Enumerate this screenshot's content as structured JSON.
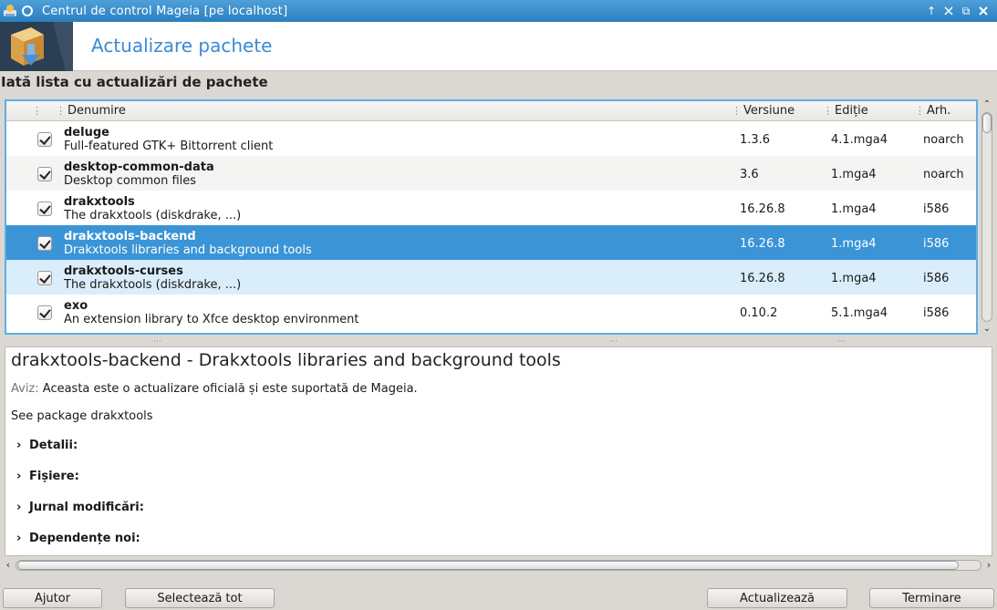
{
  "window": {
    "title": "Centrul de control Mageia  [pe localhost]",
    "controls": [
      "↑",
      "✕",
      "⧉",
      "✕"
    ]
  },
  "banner": {
    "title": "Actualizare pachete"
  },
  "list_heading": "Iată lista cu actualizări de pachete",
  "table": {
    "columns": {
      "name": "Denumire",
      "version": "Versiune",
      "release": "Ediție",
      "arch": "Arh."
    },
    "rows": [
      {
        "name": "deluge",
        "summary": "Full-featured GTK+ Bittorrent client",
        "version": "1.3.6",
        "release": "4.1.mga4",
        "arch": "noarch",
        "checked": true
      },
      {
        "name": "desktop-common-data",
        "summary": "Desktop common files",
        "version": "3.6",
        "release": "1.mga4",
        "arch": "noarch",
        "checked": true
      },
      {
        "name": "drakxtools",
        "summary": "The drakxtools (diskdrake, ...)",
        "version": "16.26.8",
        "release": "1.mga4",
        "arch": "i586",
        "checked": true
      },
      {
        "name": "drakxtools-backend",
        "summary": "Drakxtools libraries and background tools",
        "version": "16.26.8",
        "release": "1.mga4",
        "arch": "i586",
        "checked": true
      },
      {
        "name": "drakxtools-curses",
        "summary": "The drakxtools (diskdrake, ...)",
        "version": "16.26.8",
        "release": "1.mga4",
        "arch": "i586",
        "checked": true
      },
      {
        "name": "exo",
        "summary": "An extension library to Xfce desktop environment",
        "version": "0.10.2",
        "release": "5.1.mga4",
        "arch": "i586",
        "checked": true
      }
    ]
  },
  "detail": {
    "title": "drakxtools-backend - Drakxtools libraries and background tools",
    "notice_label": "Aviz:",
    "notice_text": "Aceasta este o actualizare oficială și este suportată de Mageia.",
    "see_package": "See package drakxtools",
    "sections": [
      "Detalii:",
      "Fișiere:",
      "Jurnal modificări:",
      "Dependențe noi:"
    ]
  },
  "buttons": {
    "help": "Ajutor",
    "select_all": "Selectează tot",
    "update": "Actualizează",
    "quit": "Terminare"
  },
  "colors": {
    "accent": "#3a94d6",
    "titlebar": "#2a7fc0",
    "banner_title": "#3a8ad4",
    "hover_row": "#d9eefa"
  }
}
